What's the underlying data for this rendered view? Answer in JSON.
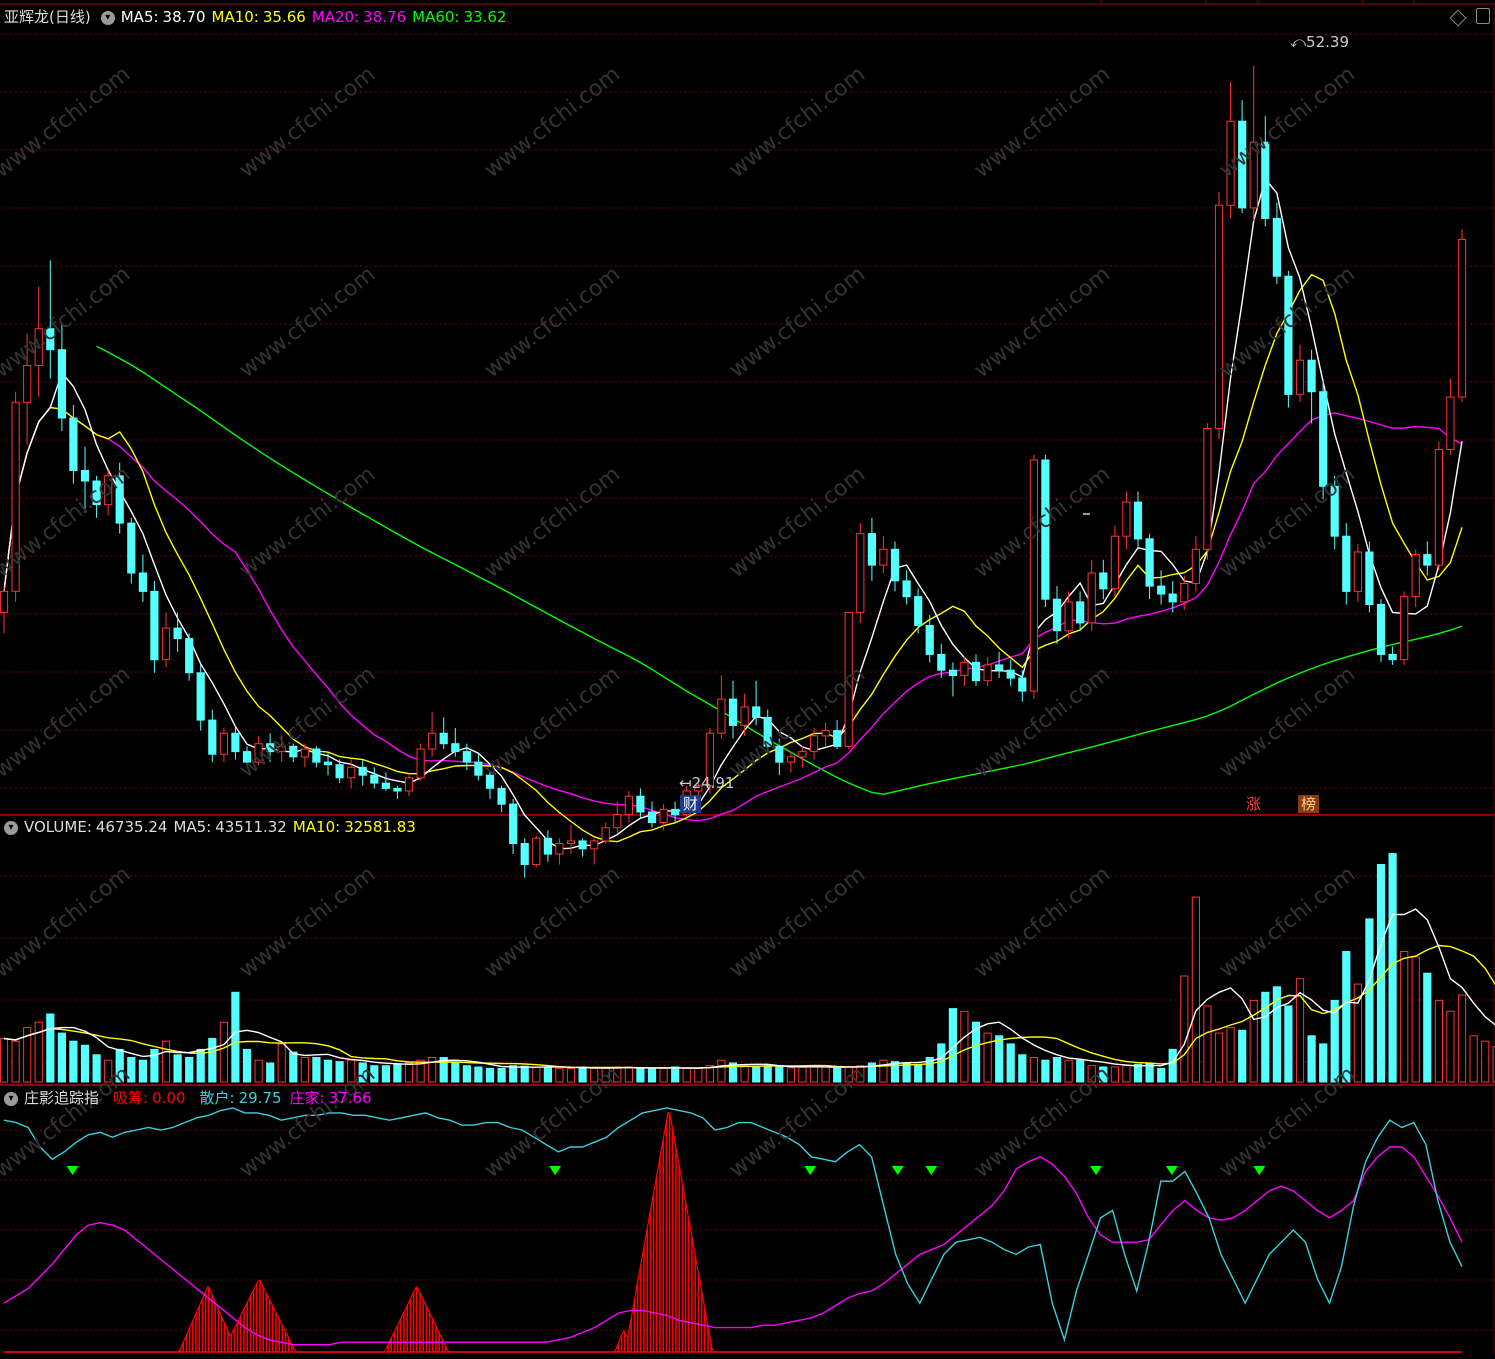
{
  "title": {
    "stock": "亚辉龙",
    "period": "(日线)",
    "ma5": {
      "label": "MA5",
      "value": "38.70",
      "color": "#ffffff"
    },
    "ma10": {
      "label": "MA10",
      "value": "35.66",
      "color": "#ffff00"
    },
    "ma20": {
      "label": "MA20",
      "value": "38.76",
      "color": "#ff00ff"
    },
    "ma60": {
      "label": "MA60",
      "value": "33.62",
      "color": "#00ff00"
    }
  },
  "volume_header": {
    "label": "VOLUME",
    "value": "46735.24",
    "ma5_label": "MA5",
    "ma5_value": "43511.32",
    "ma10_label": "MA10",
    "ma10_value": "32581.83"
  },
  "indicator_header": {
    "name": "庄影追踪指",
    "xichou_label": "吸筹",
    "xichou_value": "0.00",
    "sanhu_label": "散户",
    "sanhu_value": "29.75",
    "zhuangjia_label": "庄家",
    "zhuangjia_value": "37.66"
  },
  "annotations": {
    "high": "52.39",
    "low": "24.91",
    "tag_cai": "财",
    "tag_zhang": "涨",
    "tag_bang": "榜"
  },
  "watermark": "www.cfchi.com",
  "colors": {
    "up": "#ff3232",
    "down": "#54ffff",
    "ma5": "#ffffff",
    "ma10": "#ffff00",
    "ma20": "#ff00ff",
    "ma60": "#00ff00",
    "sanhu": "#3ccfdc",
    "zhuangjia": "#ff00ff",
    "xichou": "#ff0000",
    "signal": "#00ff00"
  },
  "chart_data": [
    {
      "type": "candlestick",
      "price_range": [
        24.0,
        54.0
      ],
      "highlighted_high": 52.39,
      "highlighted_low": 24.91,
      "ohlc": [
        [
          31.6,
          32.6,
          30.8,
          32.4
        ],
        [
          32.4,
          40.0,
          32.0,
          39.6
        ],
        [
          39.6,
          42.2,
          38.0,
          41.0
        ],
        [
          41.0,
          44.0,
          39.8,
          42.4
        ],
        [
          42.4,
          45.0,
          40.5,
          41.6
        ],
        [
          41.6,
          42.6,
          38.5,
          39.0
        ],
        [
          39.0,
          39.5,
          36.5,
          37.0
        ],
        [
          37.0,
          37.9,
          35.4,
          36.6
        ],
        [
          36.6,
          36.8,
          35.2,
          35.7
        ],
        [
          35.7,
          37.0,
          35.3,
          36.8
        ],
        [
          36.8,
          37.3,
          34.6,
          35.0
        ],
        [
          35.0,
          35.2,
          32.7,
          33.1
        ],
        [
          33.1,
          33.8,
          32.0,
          32.4
        ],
        [
          32.4,
          32.8,
          29.3,
          29.8
        ],
        [
          29.8,
          31.6,
          29.5,
          31.0
        ],
        [
          31.0,
          31.6,
          30.1,
          30.6
        ],
        [
          30.6,
          30.8,
          29.0,
          29.3
        ],
        [
          29.3,
          29.6,
          27.1,
          27.5
        ],
        [
          27.5,
          27.9,
          25.9,
          26.2
        ],
        [
          26.2,
          27.2,
          25.9,
          27.0
        ],
        [
          27.0,
          27.3,
          26.0,
          26.3
        ],
        [
          26.3,
          26.5,
          25.7,
          25.9
        ],
        [
          25.9,
          26.9,
          25.8,
          26.6
        ],
        [
          26.6,
          27.0,
          25.9,
          26.3
        ],
        [
          26.3,
          26.9,
          25.9,
          26.5
        ],
        [
          26.5,
          26.6,
          25.9,
          26.1
        ],
        [
          26.1,
          26.6,
          25.7,
          26.4
        ],
        [
          26.4,
          26.5,
          25.7,
          25.9
        ],
        [
          25.9,
          26.3,
          25.4,
          25.8
        ],
        [
          25.8,
          26.0,
          25.1,
          25.3
        ],
        [
          25.3,
          26.0,
          24.9,
          25.7
        ],
        [
          25.7,
          26.0,
          25.0,
          25.4
        ],
        [
          25.4,
          25.7,
          24.9,
          25.1
        ],
        [
          25.1,
          25.5,
          24.8,
          24.9
        ],
        [
          24.9,
          25.0,
          24.5,
          24.8
        ],
        [
          24.8,
          25.4,
          24.6,
          25.3
        ],
        [
          25.3,
          26.6,
          25.2,
          26.4
        ],
        [
          26.4,
          27.8,
          26.1,
          27.0
        ],
        [
          27.0,
          27.6,
          26.4,
          26.6
        ],
        [
          26.6,
          27.2,
          26.1,
          26.3
        ],
        [
          26.3,
          26.6,
          25.6,
          25.9
        ],
        [
          25.9,
          26.2,
          25.2,
          25.4
        ],
        [
          25.4,
          25.6,
          24.5,
          24.9
        ],
        [
          24.9,
          25.0,
          24.0,
          24.3
        ],
        [
          24.3,
          24.5,
          22.4,
          22.8
        ],
        [
          22.8,
          23.0,
          21.5,
          22.0
        ],
        [
          22.0,
          23.1,
          21.9,
          23.0
        ],
        [
          23.0,
          23.3,
          22.1,
          22.4
        ],
        [
          22.4,
          23.0,
          22.0,
          22.8
        ],
        [
          22.8,
          23.5,
          22.4,
          22.9
        ],
        [
          22.9,
          23.0,
          22.3,
          22.6
        ],
        [
          22.6,
          23.0,
          22.0,
          22.9
        ],
        [
          22.9,
          23.6,
          22.8,
          23.4
        ],
        [
          23.4,
          24.4,
          23.2,
          23.9
        ],
        [
          23.9,
          24.8,
          23.6,
          24.6
        ],
        [
          24.6,
          24.9,
          23.8,
          24.0
        ],
        [
          24.0,
          24.4,
          23.4,
          23.6
        ],
        [
          23.6,
          24.3,
          23.3,
          24.1
        ],
        [
          24.1,
          24.4,
          23.6,
          23.9
        ],
        [
          23.9,
          25.0,
          23.8,
          24.8
        ],
        [
          24.8,
          25.3,
          24.0,
          25.0
        ],
        [
          25.0,
          27.2,
          24.7,
          27.0
        ],
        [
          27.0,
          29.2,
          26.8,
          28.3
        ],
        [
          28.3,
          29.0,
          26.8,
          27.3
        ],
        [
          27.3,
          28.5,
          26.9,
          28.0
        ],
        [
          28.0,
          29.0,
          27.3,
          27.6
        ],
        [
          27.6,
          27.9,
          26.3,
          26.5
        ],
        [
          26.5,
          26.8,
          25.4,
          25.9
        ],
        [
          25.9,
          26.3,
          25.5,
          26.1
        ],
        [
          26.1,
          26.5,
          25.7,
          26.3
        ],
        [
          26.3,
          27.2,
          26.0,
          26.9
        ],
        [
          26.9,
          27.4,
          26.5,
          27.1
        ],
        [
          27.1,
          27.5,
          26.4,
          26.5
        ],
        [
          26.5,
          31.6,
          26.4,
          31.6
        ],
        [
          31.6,
          35.0,
          31.2,
          34.6
        ],
        [
          34.6,
          35.2,
          32.8,
          33.4
        ],
        [
          33.4,
          34.5,
          33.1,
          34.0
        ],
        [
          34.0,
          34.3,
          32.4,
          32.8
        ],
        [
          32.8,
          33.2,
          31.9,
          32.2
        ],
        [
          32.2,
          32.5,
          30.8,
          31.1
        ],
        [
          31.1,
          31.5,
          29.7,
          30.0
        ],
        [
          30.0,
          30.4,
          29.1,
          29.4
        ],
        [
          29.4,
          29.7,
          28.4,
          29.2
        ],
        [
          29.2,
          29.9,
          28.8,
          29.7
        ],
        [
          29.7,
          30.0,
          28.8,
          29.0
        ],
        [
          29.0,
          29.9,
          28.8,
          29.6
        ],
        [
          29.6,
          30.1,
          29.1,
          29.4
        ],
        [
          29.4,
          29.8,
          28.8,
          29.1
        ],
        [
          29.1,
          29.4,
          28.2,
          28.6
        ],
        [
          28.6,
          37.6,
          28.3,
          37.4
        ],
        [
          37.4,
          37.6,
          31.8,
          32.1
        ],
        [
          32.1,
          32.6,
          30.4,
          30.9
        ],
        [
          30.9,
          32.4,
          30.6,
          32.0
        ],
        [
          32.0,
          32.4,
          30.9,
          31.2
        ],
        [
          31.2,
          33.6,
          30.9,
          33.1
        ],
        [
          33.1,
          33.6,
          32.1,
          32.5
        ],
        [
          32.5,
          34.9,
          32.2,
          34.5
        ],
        [
          34.5,
          36.2,
          34.0,
          35.8
        ],
        [
          35.8,
          36.2,
          34.0,
          34.4
        ],
        [
          34.4,
          34.6,
          32.1,
          32.6
        ],
        [
          32.6,
          33.2,
          31.9,
          32.3
        ],
        [
          32.3,
          32.8,
          31.6,
          32.0
        ],
        [
          32.0,
          33.0,
          31.7,
          32.7
        ],
        [
          32.7,
          34.5,
          32.4,
          34.0
        ],
        [
          34.0,
          38.8,
          33.6,
          38.6
        ],
        [
          38.6,
          47.6,
          38.2,
          47.1
        ],
        [
          47.1,
          51.8,
          46.6,
          50.3
        ],
        [
          50.3,
          51.1,
          46.8,
          47.0
        ],
        [
          47.0,
          52.4,
          46.5,
          49.5
        ],
        [
          49.5,
          50.5,
          46.3,
          46.6
        ],
        [
          46.6,
          47.2,
          44.1,
          44.4
        ],
        [
          44.4,
          44.6,
          39.4,
          39.9
        ],
        [
          39.9,
          41.8,
          39.6,
          41.2
        ],
        [
          41.2,
          41.6,
          38.8,
          40.0
        ],
        [
          40.0,
          40.5,
          35.9,
          36.4
        ],
        [
          36.4,
          36.8,
          34.0,
          34.5
        ],
        [
          34.5,
          35.0,
          31.9,
          32.4
        ],
        [
          32.4,
          34.2,
          32.0,
          33.9
        ],
        [
          33.9,
          34.3,
          31.6,
          31.9
        ],
        [
          31.9,
          32.1,
          29.7,
          30.0
        ],
        [
          30.0,
          30.3,
          29.6,
          29.8
        ],
        [
          29.8,
          32.4,
          29.6,
          32.2
        ],
        [
          32.2,
          34.0,
          31.8,
          33.8
        ],
        [
          33.8,
          34.3,
          33.0,
          33.4
        ],
        [
          33.4,
          38.1,
          33.2,
          37.8
        ],
        [
          37.8,
          40.5,
          37.6,
          39.8
        ],
        [
          39.8,
          46.2,
          39.6,
          45.8
        ]
      ],
      "ma_windows": [
        5,
        10,
        20,
        60
      ],
      "ma60_start": [
        30.0,
        39.8,
        39.5,
        38.9,
        38.4,
        37.8
      ]
    },
    {
      "type": "bar",
      "name": "VOLUME",
      "ma_windows": [
        5,
        10
      ],
      "volume_range": [
        0,
        89000
      ],
      "values": [
        16000,
        15000,
        20000,
        22000,
        25000,
        18000,
        15000,
        13500,
        10000,
        8000,
        12000,
        9000,
        8000,
        12000,
        15000,
        10000,
        9000,
        12000,
        16000,
        22000,
        33000,
        12000,
        8000,
        7000,
        14000,
        11000,
        9000,
        9000,
        8000,
        7500,
        8000,
        7000,
        6000,
        6000,
        6500,
        7000,
        8000,
        9000,
        9000,
        7000,
        6000,
        5500,
        5000,
        5000,
        6000,
        5800,
        5500,
        5500,
        5000,
        5000,
        5500,
        5000,
        5000,
        5500,
        5500,
        5000,
        5000,
        5000,
        5500,
        5000,
        5000,
        6000,
        8000,
        7000,
        6000,
        5500,
        6000,
        5500,
        5200,
        5500,
        6000,
        5500,
        5000,
        5500,
        6000,
        7000,
        8000,
        7500,
        7000,
        6500,
        9000,
        14000,
        27000,
        26000,
        22000,
        18000,
        17000,
        14000,
        10000,
        9000,
        8000,
        9000,
        8000,
        8000,
        6000,
        5500,
        5500,
        6000,
        6500,
        7000,
        5000,
        12000,
        39000,
        68000,
        28000,
        18000,
        20000,
        19000,
        30000,
        33000,
        35000,
        28000,
        38000,
        17000,
        14000,
        30000,
        48000,
        36000,
        60000,
        80000,
        84000,
        48000,
        46000,
        40000,
        30000,
        26000,
        32000,
        17000,
        15000,
        13000,
        15000,
        12000,
        9000,
        21000,
        17000,
        28000,
        30000,
        28000
      ]
    },
    {
      "type": "line",
      "name": "庄影追踪指",
      "y_range": [
        0,
        100
      ],
      "series_keys": [
        "sanhu",
        "zhuangjia",
        "xichou"
      ],
      "sanhu": [
        95,
        94,
        92,
        84,
        79,
        82,
        86,
        89,
        90,
        88,
        90,
        91,
        92,
        91,
        92,
        94,
        96,
        97,
        99,
        100,
        98,
        98,
        97,
        95,
        96,
        97,
        97,
        98,
        98,
        97,
        97,
        96,
        95,
        96,
        97,
        98,
        96,
        95,
        93,
        93,
        94,
        94,
        92,
        91,
        88,
        85,
        82,
        84,
        84,
        86,
        88,
        92,
        95,
        98,
        99,
        100,
        99,
        98,
        96,
        91,
        92,
        94,
        94,
        92,
        90,
        88,
        85,
        80,
        79,
        78,
        82,
        85,
        80,
        60,
        40,
        28,
        20,
        30,
        40,
        45,
        46,
        47,
        45,
        42,
        40,
        43,
        44,
        20,
        5,
        25,
        40,
        55,
        58,
        40,
        25,
        45,
        70,
        70,
        74,
        65,
        55,
        40,
        30,
        20,
        30,
        40,
        45,
        50,
        45,
        30,
        20,
        35,
        60,
        78,
        88,
        95,
        92,
        94,
        85,
        62,
        45,
        35
      ],
      "zhuangjia": [
        20,
        23,
        26,
        31,
        36,
        42,
        48,
        52,
        53,
        52,
        50,
        46,
        42,
        38,
        34,
        30,
        26,
        22,
        18,
        14,
        10,
        7,
        5,
        4,
        3,
        3,
        3,
        3,
        4,
        4,
        4,
        4,
        4,
        4,
        4,
        4,
        4,
        4,
        4,
        4,
        4,
        4,
        4,
        4,
        4,
        4,
        5,
        6,
        8,
        10,
        13,
        16,
        17,
        17,
        16,
        15,
        13,
        12,
        11,
        10,
        10,
        10,
        10,
        11,
        11,
        12,
        13,
        14,
        16,
        19,
        22,
        24,
        25,
        28,
        32,
        36,
        40,
        42,
        44,
        48,
        52,
        56,
        60,
        66,
        75,
        78,
        80,
        77,
        72,
        65,
        55,
        48,
        45,
        45,
        45,
        46,
        52,
        58,
        62,
        58,
        55,
        54,
        55,
        58,
        62,
        66,
        68,
        66,
        62,
        58,
        55,
        58,
        62,
        74,
        80,
        84,
        84,
        80,
        72,
        64,
        55,
        45
      ],
      "xichou": [
        0,
        0,
        0,
        0,
        0,
        0,
        0,
        0,
        0,
        0,
        0,
        0,
        0,
        0,
        0,
        0,
        0,
        0,
        0,
        0,
        0,
        0,
        0,
        0,
        0,
        0,
        0,
        0,
        0,
        0,
        0,
        0,
        0,
        0,
        0,
        0,
        0,
        0,
        0,
        0,
        0,
        0,
        0,
        0,
        0,
        0,
        0,
        0,
        0,
        0,
        0,
        0,
        0,
        0,
        0,
        0,
        0,
        0,
        0,
        0,
        0,
        0,
        0,
        0,
        0,
        0,
        0,
        0,
        0,
        0,
        0,
        0,
        0,
        0,
        0,
        0,
        0,
        0,
        0,
        0,
        0,
        0,
        0,
        0,
        0,
        0,
        0,
        0,
        0,
        0,
        0,
        0,
        0,
        0,
        0,
        0,
        0,
        0,
        0,
        0,
        0,
        0,
        0,
        0,
        0,
        0,
        0,
        0,
        0,
        0,
        0,
        0,
        0,
        0,
        0,
        0,
        0,
        0,
        0,
        0,
        0,
        0
      ],
      "xichou_peaks": [
        {
          "center_frac": 0.14,
          "height": 27,
          "width_frac": 0.02
        },
        {
          "center_frac": 0.175,
          "height": 30,
          "width_frac": 0.025
        },
        {
          "center_frac": 0.283,
          "height": 27,
          "width_frac": 0.022
        },
        {
          "center_frac": 0.425,
          "height": 9,
          "width_frac": 0.006
        },
        {
          "center_frac": 0.456,
          "height": 100,
          "width_frac": 0.03
        }
      ],
      "signals_frac": [
        0.047,
        0.378,
        0.553,
        0.613,
        0.636,
        0.749,
        0.801,
        0.861
      ]
    }
  ]
}
